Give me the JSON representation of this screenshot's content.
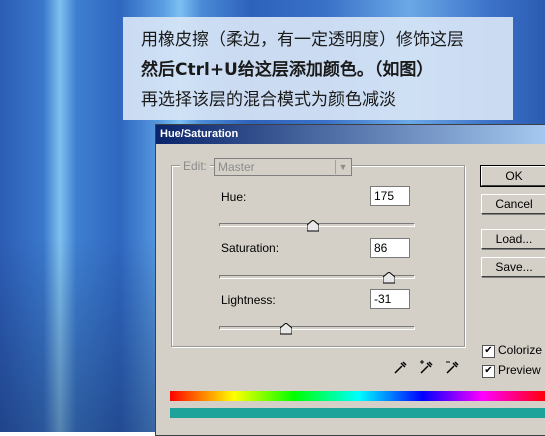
{
  "caption": {
    "line1": "用橡皮擦（柔边，有一定透明度）修饰这层",
    "line2": "然后Ctrl+U给这层添加颜色。（如图）",
    "line3": "再选择该层的混合模式为颜色减淡"
  },
  "dialog": {
    "title": "Hue/Saturation",
    "edit_label": "Edit:",
    "edit_value": "Master",
    "hue_label": "Hue:",
    "hue_value": "175",
    "saturation_label": "Saturation:",
    "saturation_value": "86",
    "lightness_label": "Lightness:",
    "lightness_value": "-31",
    "ok_label": "OK",
    "cancel_label": "Cancel",
    "load_label": "Load...",
    "save_label": "Save...",
    "colorize_label": "Colorize",
    "colorize_checked": true,
    "preview_label": "Preview",
    "preview_checked": true,
    "colorize_color": "#1ea39a"
  },
  "icons": [
    "eyedropper-icon",
    "eyedropper-plus-icon",
    "eyedropper-minus-icon",
    "chevron-down-icon",
    "check-icon"
  ]
}
